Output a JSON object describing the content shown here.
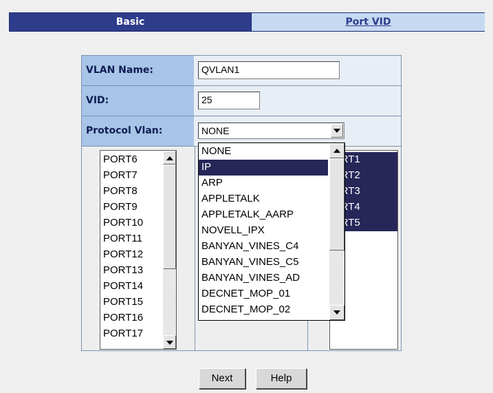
{
  "tabs": [
    {
      "label": "Basic",
      "active": true
    },
    {
      "label": "Port VID",
      "active": false
    }
  ],
  "form": {
    "vlan_name_label": "VLAN Name:",
    "vlan_name_value": "QVLAN1",
    "vid_label": "VID:",
    "vid_value": "25",
    "protocol_label": "Protocol Vlan:",
    "protocol_selected": "NONE",
    "protocol_options": [
      "NONE",
      "IP",
      "ARP",
      "APPLETALK",
      "APPLETALK_AARP",
      "NOVELL_IPX",
      "BANYAN_VINES_C4",
      "BANYAN_VINES_C5",
      "BANYAN_VINES_AD",
      "DECNET_MOP_01",
      "DECNET_MOP_02"
    ],
    "protocol_highlighted": "IP"
  },
  "available_ports": [
    "PORT6",
    "PORT7",
    "PORT8",
    "PORT9",
    "PORT10",
    "PORT11",
    "PORT12",
    "PORT13",
    "PORT14",
    "PORT15",
    "PORT16",
    "PORT17"
  ],
  "member_ports": [
    "ORT1",
    "ORT2",
    "ORT3",
    "ORT4",
    "ORT5"
  ],
  "buttons": {
    "next": "Next",
    "help": "Help"
  },
  "colors": {
    "tab_active": "#2e3c8c",
    "tab_inactive": "#c5d9f1",
    "label_bg": "#a8c4e6",
    "selection": "#262659"
  }
}
